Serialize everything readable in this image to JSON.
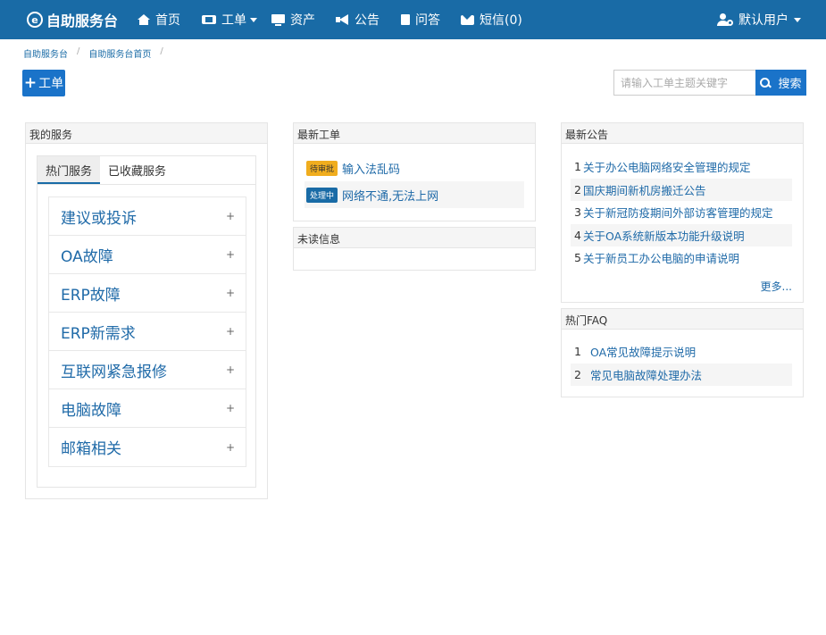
{
  "nav": {
    "brand": "自助服务台",
    "items": [
      {
        "label": "首页",
        "icon": "home-icon"
      },
      {
        "label": "工单",
        "icon": "ticket-icon"
      },
      {
        "label": "资产",
        "icon": "monitor-icon"
      },
      {
        "label": "公告",
        "icon": "bullhorn-icon"
      },
      {
        "label": "问答",
        "icon": "file-icon"
      },
      {
        "label": "短信(0)",
        "icon": "mail-icon"
      }
    ],
    "user": "默认用户"
  },
  "breadcrumb": [
    "自助服务台",
    "自助服务台首页"
  ],
  "toolbar": {
    "add_label": "工单",
    "search_placeholder": "请输入工单主题关键字",
    "search_label": "搜索"
  },
  "my_services": {
    "title": "我的服务",
    "tabs": [
      "热门服务",
      "已收藏服务"
    ],
    "items": [
      "建议或投诉",
      "OA故障",
      "ERP故障",
      "ERP新需求",
      "互联网紧急报修",
      "电脑故障",
      "邮箱相关"
    ],
    "plus": "+"
  },
  "latest_tickets": {
    "title": "最新工单",
    "items": [
      {
        "status": "待审批",
        "title": "输入法乱码"
      },
      {
        "status": "处理中",
        "title": "网络不通,无法上网"
      }
    ]
  },
  "unread": {
    "title": "未读信息"
  },
  "announcements": {
    "title": "最新公告",
    "items": [
      {
        "num": "1",
        "title": "关于办公电脑网络安全管理的规定"
      },
      {
        "num": "2",
        "title": "国庆期间新机房搬迁公告"
      },
      {
        "num": "3",
        "title": "关于新冠防疫期间外部访客管理的规定"
      },
      {
        "num": "4",
        "title": "关于OA系统新版本功能升级说明"
      },
      {
        "num": "5",
        "title": "关于新员工办公电脑的申请说明"
      }
    ],
    "more": "更多..."
  },
  "faq": {
    "title": "热门FAQ",
    "items": [
      {
        "num": "1",
        "title": "OA常见故障提示说明"
      },
      {
        "num": "2",
        "title": "常见电脑故障处理办法"
      }
    ]
  },
  "colors": {
    "navbar": "#196ba6",
    "primary_button": "#1a73c9",
    "link": "#1f6aa8",
    "badge_pending": "#f0ad1e"
  }
}
